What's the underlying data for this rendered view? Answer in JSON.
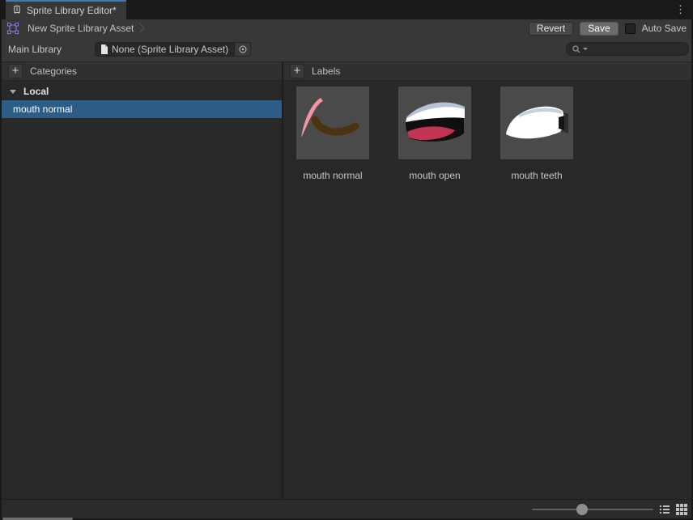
{
  "window": {
    "tab_title": "Sprite Library Editor*",
    "kebab_glyph": "⋮"
  },
  "toolbar": {
    "breadcrumb_label": "New Sprite Library Asset",
    "revert_label": "Revert",
    "save_label": "Save",
    "auto_save_label": "Auto Save",
    "auto_save_checked": false
  },
  "main_library_row": {
    "label": "Main Library",
    "object_value": "None (Sprite Library Asset)",
    "search_value": "",
    "search_placeholder": ""
  },
  "categories_panel": {
    "title": "Categories",
    "add_glyph": "+",
    "groups": [
      {
        "name": "Local",
        "expanded": true,
        "items": [
          {
            "name": "mouth normal",
            "selected": true
          }
        ]
      }
    ]
  },
  "labels_panel": {
    "title": "Labels",
    "add_glyph": "+",
    "items": [
      {
        "name": "mouth normal"
      },
      {
        "name": "mouth open"
      },
      {
        "name": "mouth teeth"
      }
    ]
  },
  "bottom_bar": {
    "slider_percent": 41
  },
  "colors": {
    "selection_blue": "#2C5D87",
    "tab_accent": "#3A79BB",
    "asset_icon_purple": "#8A7FE8"
  }
}
